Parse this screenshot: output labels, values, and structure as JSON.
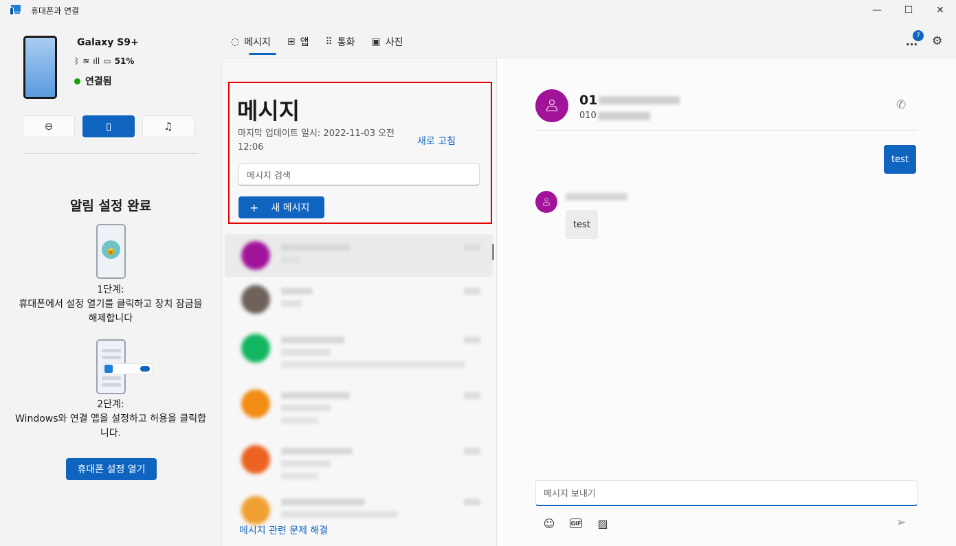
{
  "window": {
    "title": "휴대폰과 연결",
    "minimize": "—",
    "maximize": "☐",
    "close": "✕"
  },
  "device": {
    "name": "Galaxy S9+",
    "battery": "51%",
    "status": "연결됨",
    "icons": {
      "bluetooth": "ᛒ",
      "wifi": "≋",
      "signal": "ıll",
      "battery": "▭"
    }
  },
  "quick_actions": [
    {
      "icon": "⊖",
      "name": "do-not-disturb"
    },
    {
      "icon": "▯",
      "name": "vibrate"
    },
    {
      "icon": "♫",
      "name": "media"
    }
  ],
  "setup": {
    "title": "알림 설정 완료",
    "step1": "1단계:\n휴대폰에서 설정 열기를 클릭하고 장치 잠금을 해제합니다",
    "step2": "2단계:\nWindows와 연결 앱을 설정하고 허용을 클릭합니다.",
    "button": "휴대폰 설정 열기"
  },
  "tabs": [
    {
      "label": "메시지",
      "icon": "◌"
    },
    {
      "label": "앱",
      "icon": "⊞"
    },
    {
      "label": "통화",
      "icon": "⠿"
    },
    {
      "label": "사진",
      "icon": "▣"
    }
  ],
  "header": {
    "more": "...",
    "notification_count": "7",
    "settings_icon": "⚙"
  },
  "messages": {
    "title": "메시지",
    "updated": "마지막 업데이트 일시: 2022-11-03 오전 12:06",
    "refresh": "새로 고침",
    "search_placeholder": "메시지 검색",
    "new_message": "새 메시지",
    "troubleshoot": "메시지 관련 문제 해결"
  },
  "chat": {
    "contact_prefix": "01",
    "number_prefix": "010",
    "outgoing_text": "test",
    "incoming_text": "test",
    "compose_placeholder": "메시지 보내기"
  },
  "colors": {
    "accent": "#0f64c0",
    "highlight_border": "#e30000",
    "contact_avatar": "#a1149a",
    "online": "#13a10e"
  }
}
